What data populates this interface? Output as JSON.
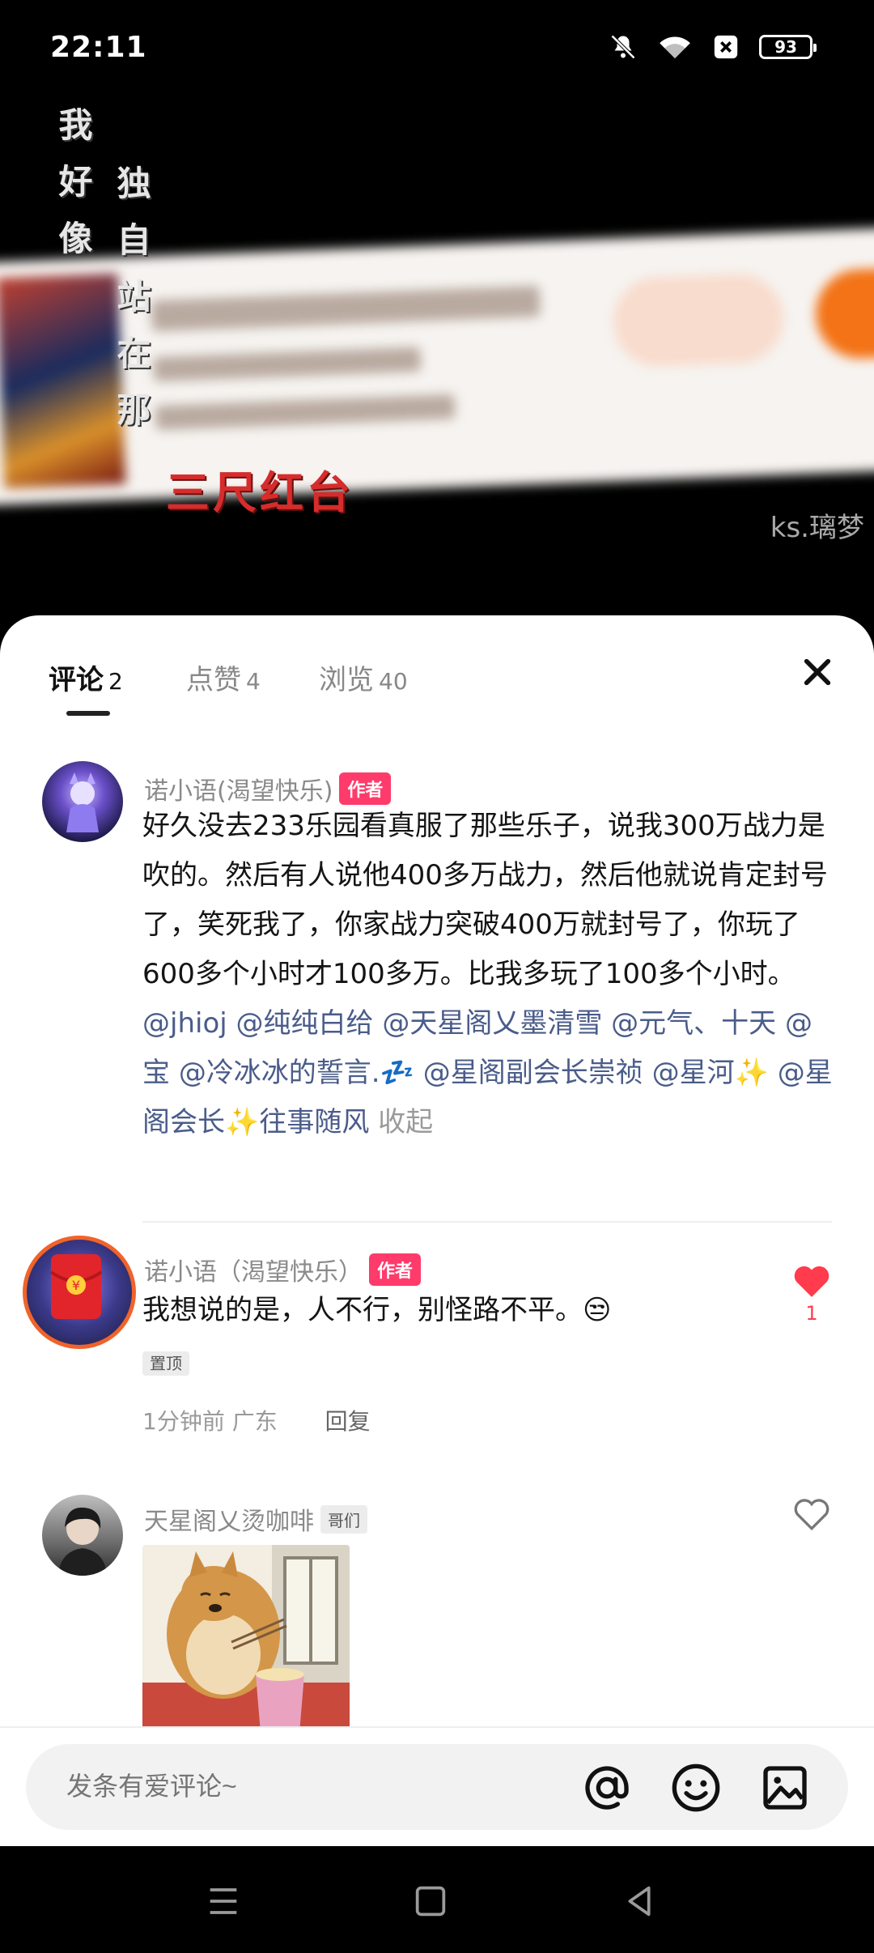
{
  "status_bar": {
    "time": "22:11",
    "battery": "93",
    "icons": [
      "bell-off-icon",
      "wifi-icon",
      "close-box-icon",
      "battery-icon"
    ]
  },
  "video": {
    "overlay_vertical_lines": [
      "我好像",
      "独自站在那"
    ],
    "red_title": "三尺红台",
    "watermark": "ks.璃梦"
  },
  "sheet": {
    "tabs": [
      {
        "label": "评论",
        "count": "2"
      },
      {
        "label": "点赞",
        "count": "4"
      },
      {
        "label": "浏览",
        "count": "40"
      }
    ],
    "comments": [
      {
        "author": "诺小语(渴望快乐)",
        "badge": "作者",
        "text": "好久没去233乐园看真服了那些乐子，说我300万战力是吹的。然后有人说他400多万战力，然后他就说肯定封号了，笑死我了，你家战力突破400万就封号了，你玩了600多个小时才100多万。比我多玩了100多个小时。",
        "mentions": [
          "@jhioj",
          "@纯纯白给",
          "@天星阁乂墨清雪",
          "@元气、十天",
          "@宝",
          "@冷冰冰的誓言.💤",
          "@星阁副会长崇祯",
          "@星河✨",
          "@星阁会长✨往事随风"
        ],
        "collapse_label": "收起"
      },
      {
        "author": "诺小语（渴望快乐）",
        "badge": "作者",
        "text": "我想说的是，人不行，别怪路不平。😒",
        "pinned_label": "置顶",
        "time": "1分钟前",
        "location": "广东",
        "reply_label": "回复",
        "likes": "1",
        "liked": true
      },
      {
        "author": "天星阁乂烫咖啡",
        "badge": "哥们",
        "image_alt": "shiba-inu-eating-noodles",
        "liked": false
      }
    ]
  },
  "composer": {
    "placeholder": "发条有爱评论~",
    "icons": [
      "at-icon",
      "emoji-icon",
      "image-icon"
    ]
  },
  "colors": {
    "author_badge": "#ff3b6b",
    "like_red": "#ff3b4d",
    "mention": "#4a5c8a",
    "accent_orange": "#f37316"
  }
}
